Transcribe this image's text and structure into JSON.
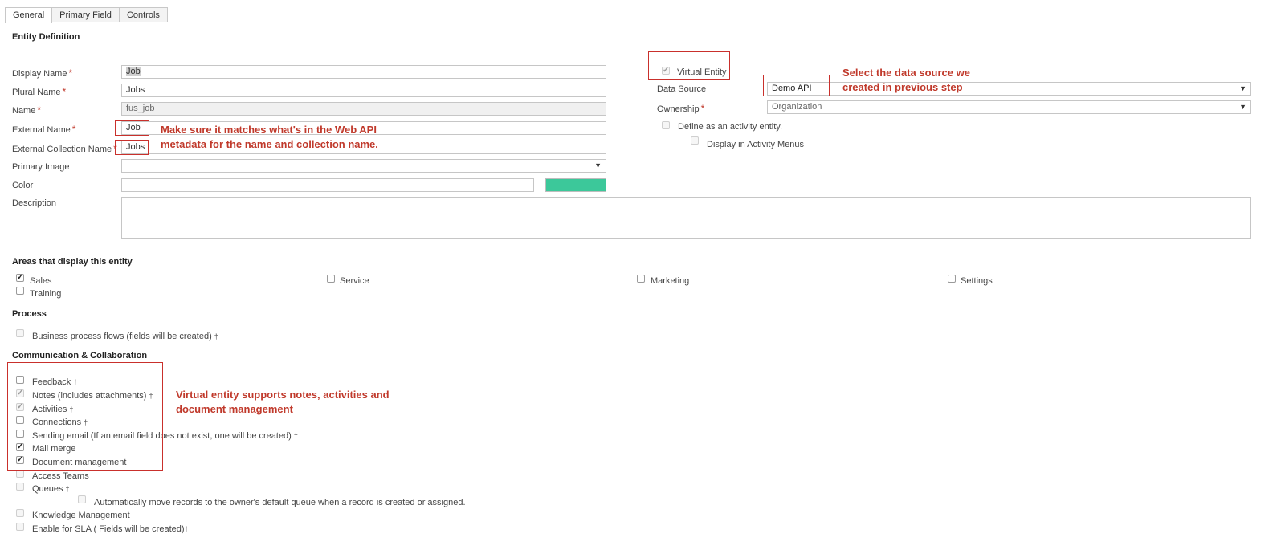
{
  "tabs": [
    {
      "label": "General",
      "active": true
    },
    {
      "label": "Primary Field",
      "active": false
    },
    {
      "label": "Controls",
      "active": false
    }
  ],
  "entity_definition": {
    "title": "Entity Definition",
    "fields": {
      "display_name": {
        "label": "Display Name",
        "value": "Job",
        "required": true
      },
      "plural_name": {
        "label": "Plural Name",
        "value": "Jobs",
        "required": true
      },
      "name": {
        "label": "Name",
        "value": "fus_job",
        "required": true
      },
      "external_name": {
        "label": "External Name",
        "value": "Job",
        "required": true
      },
      "external_collection_name": {
        "label": "External Collection Name",
        "value": "Jobs",
        "required": true
      },
      "primary_image": {
        "label": "Primary Image",
        "value": ""
      },
      "color": {
        "label": "Color",
        "value": "",
        "swatch": "#3cc89a"
      },
      "description": {
        "label": "Description",
        "value": ""
      }
    },
    "virtual_entity": {
      "label": "Virtual Entity",
      "checked": true
    },
    "data_source": {
      "label": "Data Source",
      "value": "Demo API"
    },
    "ownership": {
      "label": "Ownership",
      "value": "Organization"
    },
    "define_activity": {
      "label": "Define as an activity entity.",
      "checked": false
    },
    "display_activity_menus": {
      "label": "Display in Activity Menus",
      "checked": false
    }
  },
  "required_marker": "*",
  "dagger": "†",
  "areas": {
    "title": "Areas that display this entity",
    "items": [
      {
        "label": "Sales",
        "checked": true
      },
      {
        "label": "Service",
        "checked": false
      },
      {
        "label": "Marketing",
        "checked": false
      },
      {
        "label": "Settings",
        "checked": false
      },
      {
        "label": "Training",
        "checked": false
      }
    ]
  },
  "process": {
    "title": "Process",
    "business_process_flows": {
      "label": "Business process flows (fields will be created)",
      "checked": false
    }
  },
  "communication": {
    "title": "Communication & Collaboration",
    "items": [
      {
        "label": "Feedback",
        "checked": false,
        "disabled": false,
        "dagger": true
      },
      {
        "label": "Notes (includes attachments)",
        "checked": true,
        "disabled": true,
        "dagger": true
      },
      {
        "label": "Activities",
        "checked": true,
        "disabled": true,
        "dagger": true
      },
      {
        "label": "Connections",
        "checked": false,
        "disabled": false,
        "dagger": true
      },
      {
        "label": "Sending email (If an email field does not exist, one will be created)",
        "checked": false,
        "disabled": false,
        "dagger": true
      },
      {
        "label": "Mail merge",
        "checked": true,
        "disabled": false,
        "dagger": false
      },
      {
        "label": "Document management",
        "checked": true,
        "disabled": false,
        "dagger": false
      },
      {
        "label": "Access Teams",
        "checked": false,
        "disabled": true,
        "dagger": false
      },
      {
        "label": "Queues",
        "checked": false,
        "disabled": true,
        "dagger": true
      },
      {
        "label": "Automatically move records to the owner's default queue when a record is created or assigned.",
        "checked": false,
        "disabled": true,
        "dagger": false
      },
      {
        "label": "Knowledge Management",
        "checked": false,
        "disabled": true,
        "dagger": false
      },
      {
        "label": "Enable for SLA ( Fields will be created)",
        "checked": false,
        "disabled": true,
        "dagger": true
      }
    ]
  },
  "annotations": {
    "external_names_line1": "Make sure it matches what's in the Web API",
    "external_names_line2": "metadata for the name and collection name.",
    "data_source_line1": "Select the data source we",
    "data_source_line2": "created in previous step",
    "virtual_entity_line1": "Virtual entity supports notes, activities and",
    "virtual_entity_line2": "document management"
  },
  "colors": {
    "annotation_red": "#c0392b",
    "swatch_green": "#3cc89a"
  }
}
